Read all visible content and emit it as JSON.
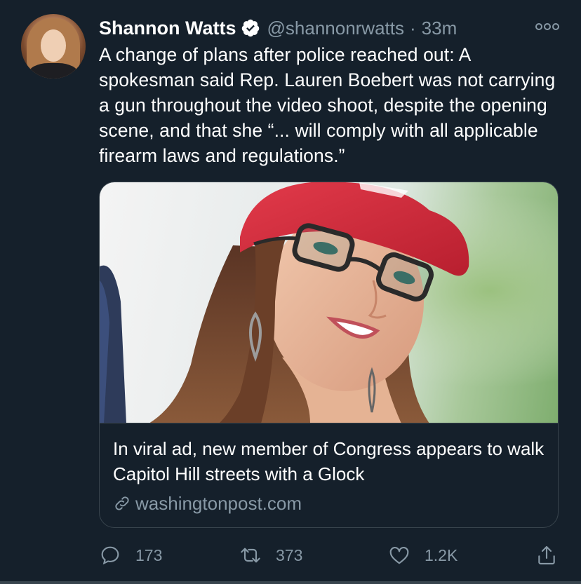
{
  "tweet": {
    "author_name": "Shannon Watts",
    "handle": "@shannonrwatts",
    "separator": "·",
    "time": "33m",
    "verified": true,
    "text": "A change of plans after police reached out: A spokesman said Rep. Lauren Boebert was not carrying a gun throughout the video shoot, despite the opening scene, and that she “... will comply with all applicable firearm laws and regulations.”"
  },
  "card": {
    "title": "In viral ad, new member of Congress appears to walk Capitol Hill streets with a Glock",
    "domain": "washingtonpost.com"
  },
  "actions": {
    "replies": "173",
    "retweets": "373",
    "likes": "1.2K"
  },
  "icons": {
    "more": "more-options-icon",
    "verified": "verified-badge-icon",
    "reply": "reply-icon",
    "retweet": "retweet-icon",
    "like": "heart-icon",
    "share": "share-icon",
    "link": "link-icon"
  },
  "colors": {
    "background": "#15202b",
    "secondary_text": "#8899a6",
    "border": "#38444d",
    "primary_text": "#ffffff"
  }
}
